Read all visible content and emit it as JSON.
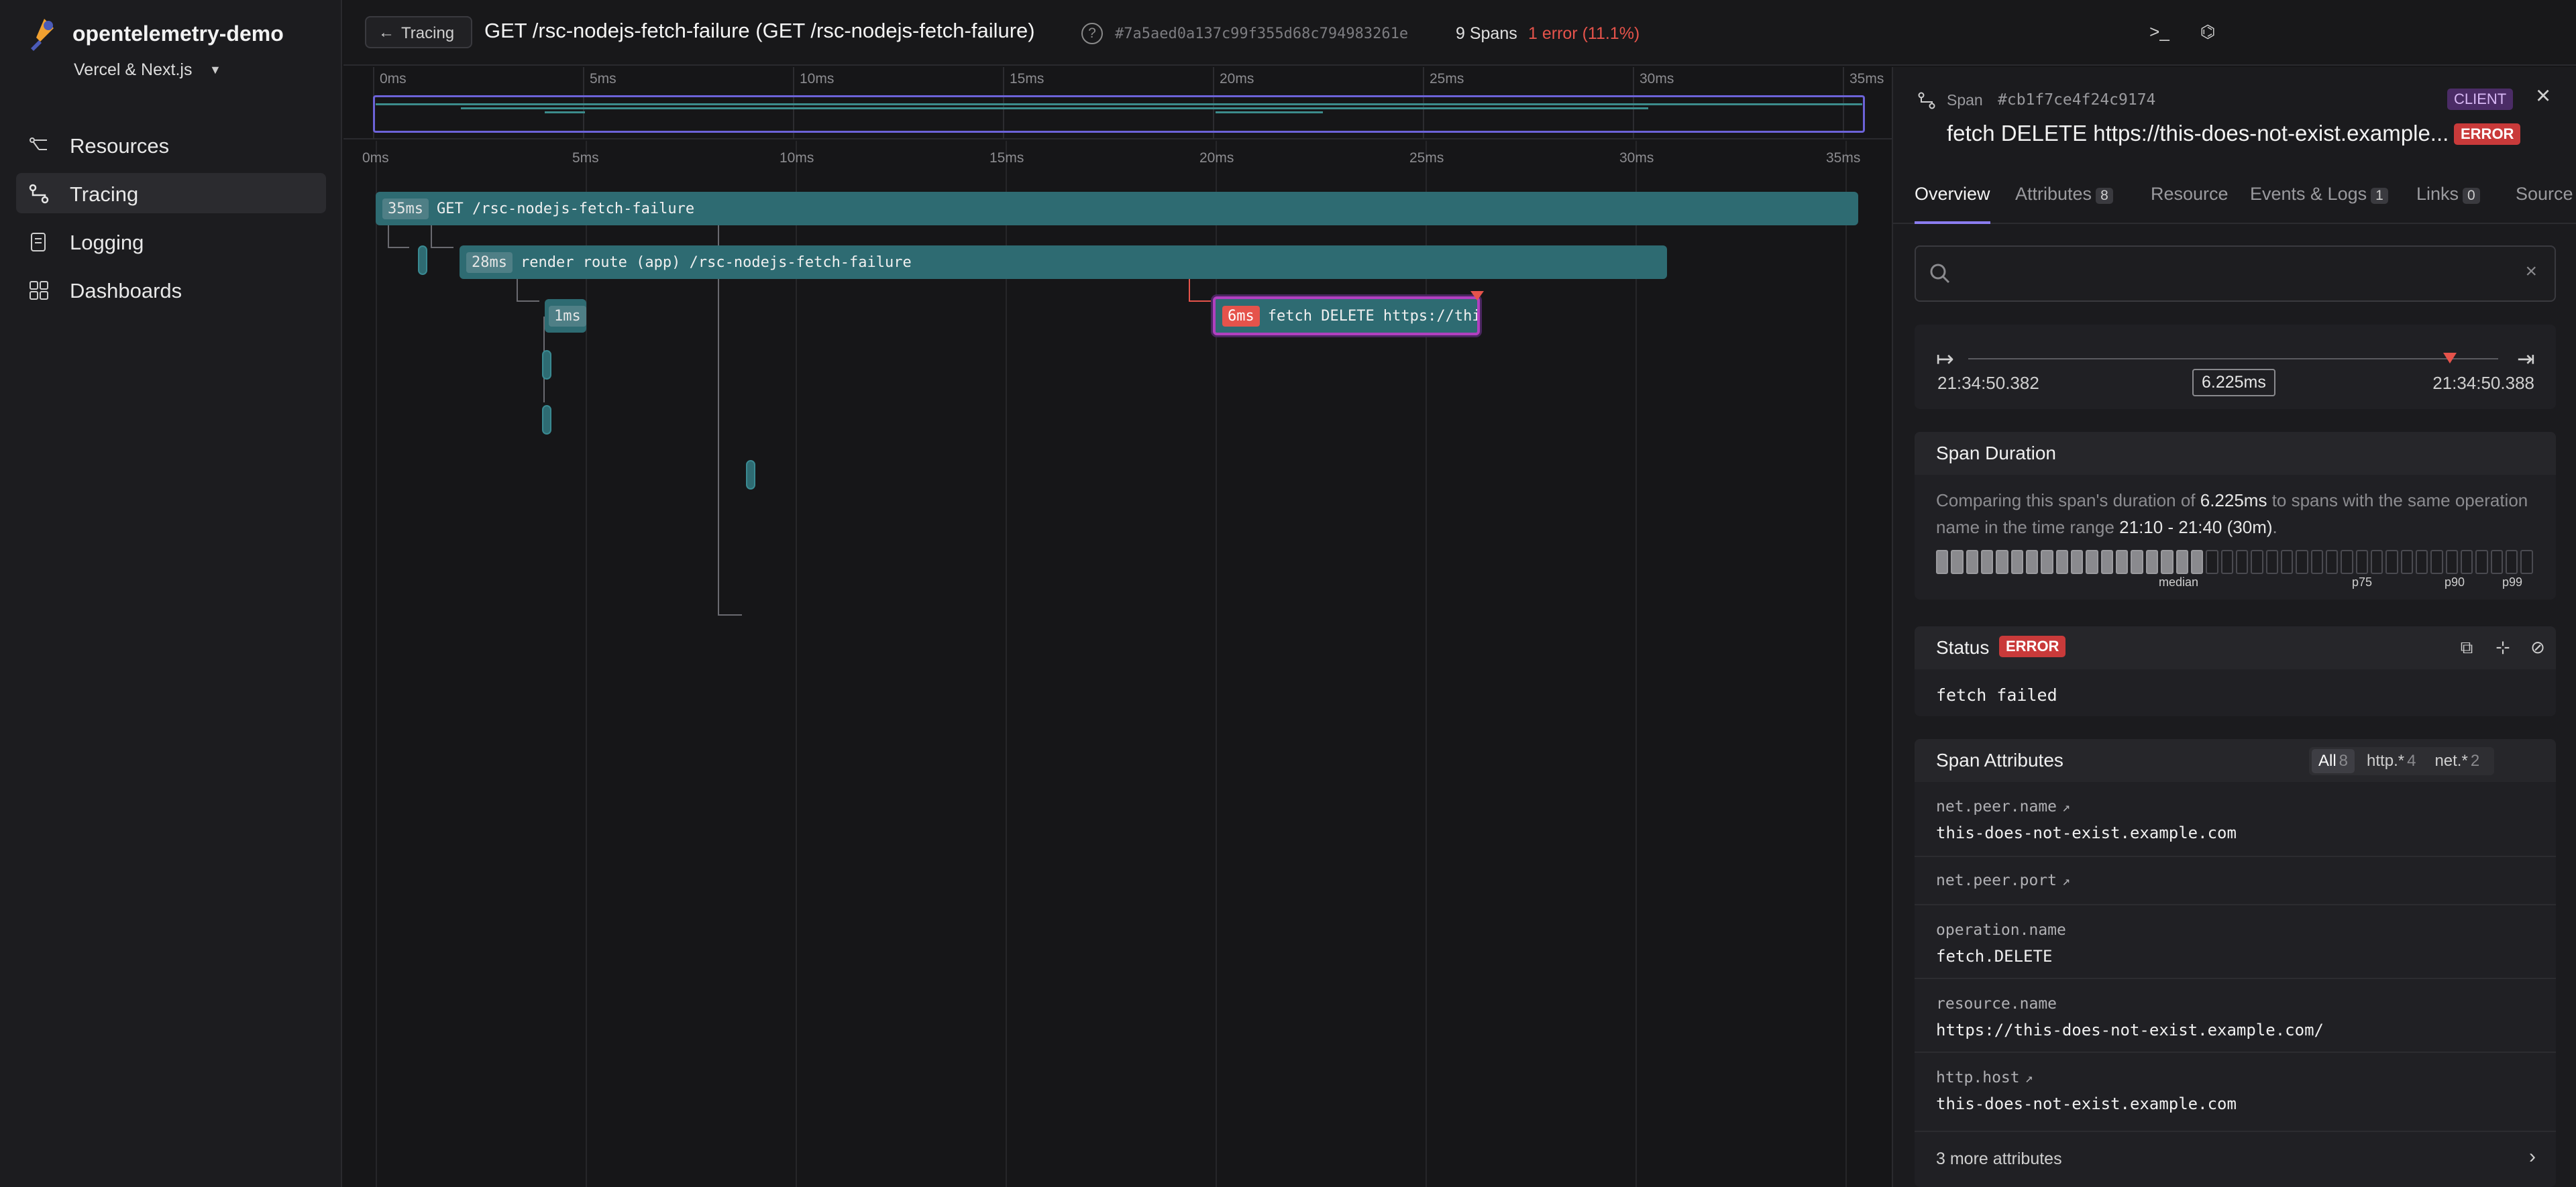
{
  "sidebar": {
    "app_name": "opentelemetry-demo",
    "environment": "Vercel & Next.js",
    "items": [
      {
        "label": "Resources",
        "icon": "resources-icon"
      },
      {
        "label": "Tracing",
        "icon": "tracing-icon",
        "active": true
      },
      {
        "label": "Logging",
        "icon": "logging-icon"
      },
      {
        "label": "Dashboards",
        "icon": "dashboards-icon"
      }
    ]
  },
  "header": {
    "back_label": "Tracing",
    "title": "GET /rsc-nodejs-fetch-failure (GET /rsc-nodejs-fetch-failure)",
    "help": "?",
    "trace_id": "#7a5aed0a137c99f355d68c794983261e",
    "spans": "9 Spans",
    "errors": "1 error (11.1%)"
  },
  "timeline": {
    "ticks": [
      "0ms",
      "5ms",
      "10ms",
      "15ms",
      "20ms",
      "25ms",
      "30ms",
      "35ms"
    ],
    "spans": [
      {
        "duration": "35ms",
        "name": "GET /rsc-nodejs-fetch-failure"
      },
      {
        "duration": "28ms",
        "name": "render route (app) /rsc-nodejs-fetch-failure"
      },
      {
        "duration": "1ms",
        "name": ""
      },
      {
        "duration": "6ms",
        "name": "fetch DELETE https://thi",
        "error": true
      }
    ]
  },
  "panel": {
    "span_label": "Span",
    "span_id": "#cb1f7ce4f24c9174",
    "kind": "CLIENT",
    "title": "fetch DELETE https://this-does-not-exist.example...",
    "title_badge": "ERROR",
    "tabs": [
      {
        "label": "Overview",
        "count": ""
      },
      {
        "label": "Attributes",
        "count": "8"
      },
      {
        "label": "Resource",
        "count": ""
      },
      {
        "label": "Events & Logs",
        "count": "1"
      },
      {
        "label": "Links",
        "count": "0"
      },
      {
        "label": "Source",
        "count": ""
      }
    ],
    "search_placeholder": "",
    "range": {
      "start": "21:34:50.382",
      "duration": "6.225ms",
      "end": "21:34:50.388"
    },
    "span_duration": {
      "title": "Span Duration",
      "text_1": "Comparing this span's duration of ",
      "value": "6.225ms",
      "text_2": " to spans with the same operation name in the time range ",
      "range": "21:10 - 21:40 (30m)",
      "text_3": ".",
      "labels": [
        "median",
        "p75",
        "p90",
        "p99"
      ],
      "filled_fraction": 0.45
    },
    "status": {
      "title": "Status",
      "badge": "ERROR",
      "message": "fetch failed"
    },
    "attributes": {
      "title": "Span Attributes",
      "filters": [
        {
          "label": "All",
          "count": "8"
        },
        {
          "label": "http.*",
          "count": "4"
        },
        {
          "label": "net.*",
          "count": "2"
        }
      ],
      "rows": [
        {
          "key": "net.peer.name",
          "value": "this-does-not-exist.example.com"
        },
        {
          "key": "net.peer.port",
          "value": ""
        },
        {
          "key": "operation.name",
          "value": "fetch.DELETE"
        },
        {
          "key": "resource.name",
          "value": "https://this-does-not-exist.example.com/"
        },
        {
          "key": "http.host",
          "value": "this-does-not-exist.example.com"
        }
      ],
      "more": "3 more attributes"
    }
  },
  "colors": {
    "accent": "#8b7cf0",
    "span": "#2e6b72",
    "error": "#e5534b",
    "client_badge": "#4b2c66"
  }
}
